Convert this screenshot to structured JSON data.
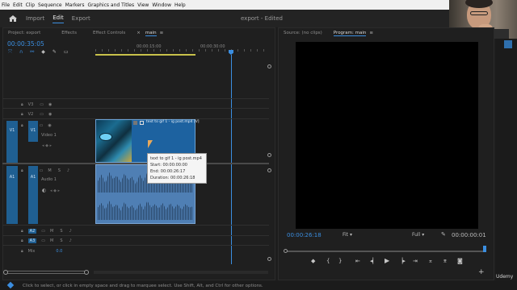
{
  "menubar": {
    "items": [
      "File",
      "Edit",
      "Clip",
      "Sequence",
      "Markers",
      "Graphics and Titles",
      "View",
      "Window",
      "Help"
    ],
    "window_controls": [
      "—",
      "☐",
      "✕"
    ]
  },
  "header": {
    "tabs": [
      {
        "label": "Import",
        "active": false
      },
      {
        "label": "Edit",
        "active": true
      },
      {
        "label": "Export",
        "active": false
      }
    ],
    "project_title": "export - Edited"
  },
  "timeline_panel": {
    "tabs": [
      "Project: export",
      "Effects",
      "Effect Controls",
      "main"
    ],
    "active_tab": "main",
    "timecode": "00:00:35:05",
    "ruler": {
      "t1": "00:00:15:00",
      "t2": "00:00:30:00"
    },
    "tracks": {
      "v3": "V3",
      "v2": "V2",
      "v1": "V1",
      "v1_source": "V1",
      "video1_label": "Video 1",
      "a1": "A1",
      "a1_source": "A1",
      "audio1_label": "Audio 1",
      "a2": "A2",
      "a3": "A3",
      "mix_label": "Mix",
      "mix_value": "0.0",
      "mute": "M",
      "solo": "S"
    },
    "clip": {
      "label": "text to gif 1 - ig post.mp4 [V]"
    },
    "tooltip": {
      "title": "text to gif 1 - ig post.mp4",
      "start": "Start: 00:00:00:00",
      "end": "End: 00:00:26:17",
      "duration": "Duration: 00:00:26:18"
    }
  },
  "monitor_panel": {
    "source_tab": "Source: (no clips)",
    "program_tab": "Program: main",
    "timecode_left": "00:00:26:18",
    "fit": "Fit",
    "quality": "Full",
    "timecode_right": "00:00:00:01"
  },
  "status_bar": "Click to select, or click in empty space and drag to marquee select. Use Shift, Alt, and Ctrl for other options.",
  "watermark": "Udemy",
  "colors": {
    "accent": "#3b8ee0",
    "clip_video": "#1d62a0",
    "clip_audio": "#4f7fb4",
    "track_tab": "#1f5f92"
  }
}
